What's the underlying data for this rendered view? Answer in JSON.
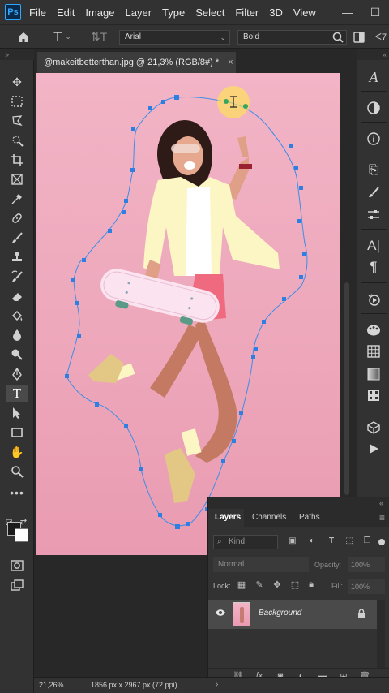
{
  "app": {
    "logo": "Ps",
    "menus": [
      "File",
      "Edit",
      "Image",
      "Layer",
      "Type",
      "Select",
      "Filter",
      "3D",
      "View"
    ],
    "window_controls": {
      "minimize": "—",
      "maximize": "☐"
    }
  },
  "options_bar": {
    "font_family": "Arial",
    "font_style": "Bold"
  },
  "document": {
    "tab_title": "@makeitbetterthan.jpg @ 21,3% (RGB/8#) *",
    "close": "×"
  },
  "status": {
    "zoom": "21,26%",
    "doc_size": "1856 px x 2967 px (72 ppi)",
    "arrow": "›"
  },
  "layers_panel": {
    "tabs": [
      "Layers",
      "Channels",
      "Paths"
    ],
    "active_tab": "Layers",
    "kind_placeholder": "Kind",
    "blend_mode": "Normal",
    "opacity_label": "Opacity:",
    "opacity_value": "100%",
    "lock_label": "Lock:",
    "fill_label": "Fill:",
    "fill_value": "100%",
    "layers": [
      {
        "name": "Background",
        "visible": true,
        "locked": true
      }
    ]
  },
  "colors": {
    "ui_dark": "#323232",
    "canvas_bg": "#282828",
    "accent_blue": "#31a8ff",
    "path_stroke": "#3b8ee8",
    "photo_pink": "#f2b4c6"
  },
  "icons": {
    "toolbar": [
      "move-icon",
      "marquee-icon",
      "lasso-icon",
      "quick-select-icon",
      "crop-icon",
      "frame-icon",
      "eyedropper-icon",
      "healing-brush-icon",
      "brush-icon",
      "clone-stamp-icon",
      "history-brush-icon",
      "eraser-icon",
      "paint-bucket-icon",
      "blur-icon",
      "dodge-icon",
      "pen-icon",
      "type-icon",
      "path-select-icon",
      "rectangle-icon",
      "hand-icon",
      "zoom-icon",
      "more-tools-icon"
    ],
    "dock": [
      "character-panel-icon",
      "adjustments-icon",
      "info-icon",
      "history-icon",
      "brushes-icon",
      "properties-icon",
      "character-icon",
      "paragraph-icon",
      "actions-icon",
      "color-icon",
      "swatches-icon",
      "gradients-icon",
      "patterns-icon",
      "3d-icon",
      "timeline-icon"
    ]
  }
}
